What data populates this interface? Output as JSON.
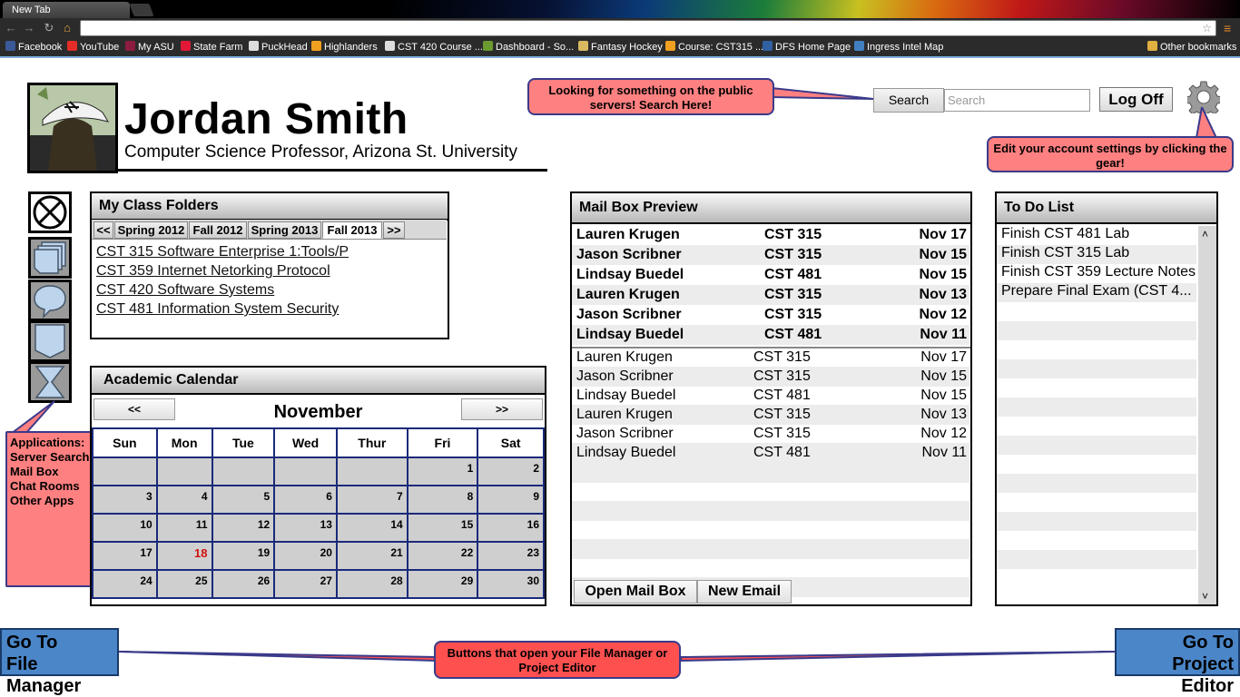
{
  "browser": {
    "tab_title": "New Tab",
    "address_value": "",
    "bookmarks": [
      {
        "label": "Facebook",
        "color": "#3b5998"
      },
      {
        "label": "YouTube",
        "color": "#e52d27"
      },
      {
        "label": "My ASU",
        "color": "#8c1d40"
      },
      {
        "label": "State Farm",
        "color": "#e31837"
      },
      {
        "label": "PuckHead",
        "color": "#dddddd"
      },
      {
        "label": "Highlanders",
        "color": "#f0a020"
      },
      {
        "label": "CST 420 Course ...",
        "color": "#dddddd"
      },
      {
        "label": "Dashboard - So...",
        "color": "#6a9a30"
      },
      {
        "label": "Fantasy Hockey",
        "color": "#d8b860"
      },
      {
        "label": "Course: CST315 ...",
        "color": "#f0a020"
      },
      {
        "label": "DFS Home Page",
        "color": "#3060a0"
      },
      {
        "label": "Ingress Intel Map",
        "color": "#4080c0"
      }
    ],
    "other_bookmarks": "Other bookmarks"
  },
  "profile": {
    "name": "Jordan Smith",
    "title": "Computer Science Professor, Arizona St. University"
  },
  "callouts": {
    "search": "Looking for something on the public servers! Search Here!",
    "gear": "Edit your account settings by clicking the gear!",
    "apps": [
      "Applications:",
      "Server Search",
      "Mail Box",
      "Chat Rooms",
      "Other Apps"
    ],
    "bottom": "Buttons that open your File Manager or Project Editor"
  },
  "header": {
    "search_label": "Search",
    "search_placeholder": "Search",
    "logoff_label": "Log Off"
  },
  "class_folders": {
    "title": "My Class Folders",
    "prev": "<<",
    "next": ">>",
    "tabs": [
      "Spring 2012",
      "Fall 2012",
      "Spring 2013",
      "Fall 2013"
    ],
    "active_tab": "Fall 2013",
    "items": [
      "CST 315 Software Enterprise 1:Tools/P",
      "CST 359 Internet Netorking Protocol",
      "CST 420 Software Systems",
      "CST 481 Information System Security"
    ]
  },
  "calendar": {
    "title": "Academic Calendar",
    "prev": "<<",
    "next": ">>",
    "month": "November",
    "days": [
      "Sun",
      "Mon",
      "Tue",
      "Wed",
      "Thur",
      "Fri",
      "Sat"
    ],
    "weeks": [
      [
        "",
        "",
        "",
        "",
        "",
        "1",
        "2"
      ],
      [
        "3",
        "4",
        "5",
        "6",
        "7",
        "8",
        "9"
      ],
      [
        "10",
        "11",
        "12",
        "13",
        "14",
        "15",
        "16"
      ],
      [
        "17",
        "18",
        "19",
        "20",
        "21",
        "22",
        "23"
      ],
      [
        "24",
        "25",
        "26",
        "27",
        "28",
        "29",
        "30"
      ]
    ],
    "today": "18",
    "today_color": "#d01010"
  },
  "mail": {
    "title": "Mail Box Preview",
    "unread": [
      {
        "from": "Lauren Krugen",
        "course": "CST 315",
        "date": "Nov 17"
      },
      {
        "from": "Jason Scribner",
        "course": "CST 315",
        "date": "Nov 15"
      },
      {
        "from": "Lindsay Buedel",
        "course": "CST 481",
        "date": "Nov 15"
      },
      {
        "from": "Lauren Krugen",
        "course": "CST 315",
        "date": "Nov 13"
      },
      {
        "from": "Jason Scribner",
        "course": "CST 315",
        "date": "Nov 12"
      },
      {
        "from": "Lindsay Buedel",
        "course": "CST 481",
        "date": "Nov 11"
      }
    ],
    "read": [
      {
        "from": "Lauren Krugen",
        "course": "CST 315",
        "date": "Nov 17"
      },
      {
        "from": "Jason Scribner",
        "course": "CST 315",
        "date": "Nov 15"
      },
      {
        "from": "Lindsay Buedel",
        "course": "CST 481",
        "date": "Nov 15"
      },
      {
        "from": "Lauren Krugen",
        "course": "CST 315",
        "date": "Nov 13"
      },
      {
        "from": "Jason Scribner",
        "course": "CST 315",
        "date": "Nov 12"
      },
      {
        "from": "Lindsay Buedel",
        "course": "CST 481",
        "date": "Nov 11"
      }
    ],
    "open_label": "Open Mail Box",
    "new_label": "New Email"
  },
  "todo": {
    "title": "To Do List",
    "items": [
      "Finish CST 481 Lab",
      "Finish CST 315 Lab",
      "Finish CST 359 Lecture Notes",
      "Prepare Final Exam (CST 4..."
    ]
  },
  "bottom_buttons": {
    "file_manager": [
      "Go To",
      "File Manager"
    ],
    "project_editor": [
      "Go To",
      "Project Editor"
    ]
  },
  "colors": {
    "callout_fill": "#ff8080",
    "callout_border": "#3a3a8a",
    "button_blue": "#4a86c8"
  }
}
